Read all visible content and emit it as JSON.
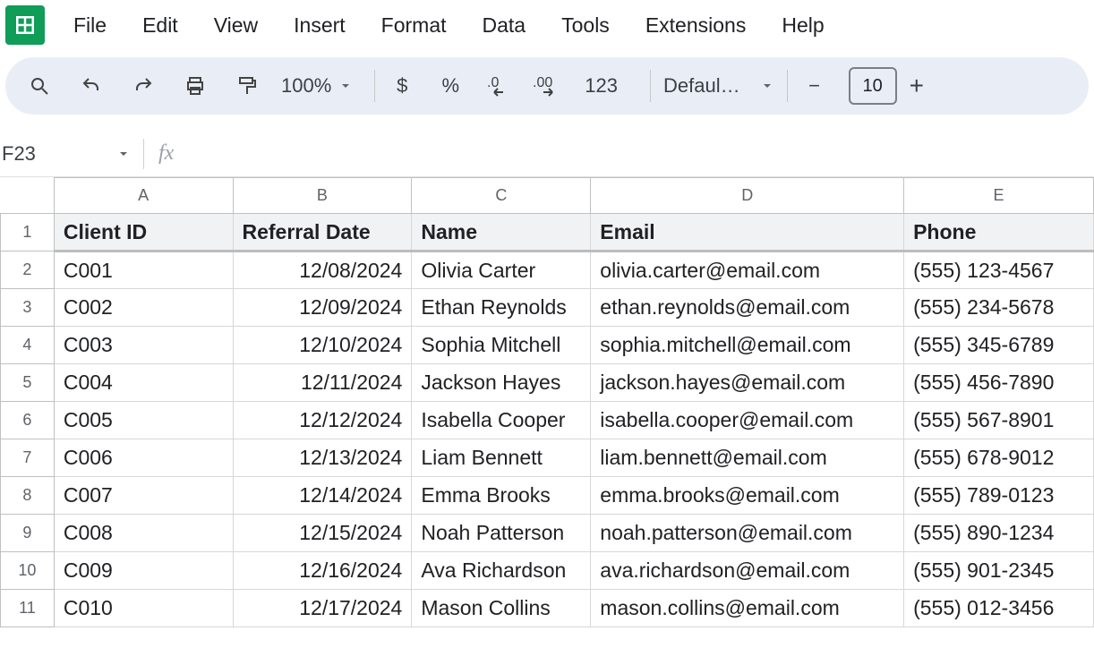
{
  "menu": {
    "file": "File",
    "edit": "Edit",
    "view": "View",
    "insert": "Insert",
    "format": "Format",
    "data": "Data",
    "tools": "Tools",
    "extensions": "Extensions",
    "help": "Help"
  },
  "toolbar": {
    "zoom": "100%",
    "currency": "$",
    "percent": "%",
    "decDecr": ".0",
    "decIncr": ".00",
    "numfmt": "123",
    "font": "Defaul…",
    "minus": "−",
    "fontsize": "10",
    "plus": "+"
  },
  "fx": {
    "namebox": "F23",
    "fx": "fx"
  },
  "columns": [
    "A",
    "B",
    "C",
    "D",
    "E"
  ],
  "rows": [
    "1",
    "2",
    "3",
    "4",
    "5",
    "6",
    "7",
    "8",
    "9",
    "10",
    "11"
  ],
  "header_row": {
    "A": "Client ID",
    "B": "Referral Date",
    "C": "Name",
    "D": "Email",
    "E": "Phone"
  },
  "data": [
    {
      "A": "C001",
      "B": "12/08/2024",
      "C": "Olivia Carter",
      "D": "olivia.carter@email.com",
      "E": "(555) 123-4567"
    },
    {
      "A": "C002",
      "B": "12/09/2024",
      "C": "Ethan Reynolds",
      "D": "ethan.reynolds@email.com",
      "E": "(555) 234-5678"
    },
    {
      "A": "C003",
      "B": "12/10/2024",
      "C": "Sophia Mitchell",
      "D": "sophia.mitchell@email.com",
      "E": "(555) 345-6789"
    },
    {
      "A": "C004",
      "B": "12/11/2024",
      "C": "Jackson Hayes",
      "D": "jackson.hayes@email.com",
      "E": "(555) 456-7890"
    },
    {
      "A": "C005",
      "B": "12/12/2024",
      "C": "Isabella Cooper",
      "D": "isabella.cooper@email.com",
      "E": "(555) 567-8901"
    },
    {
      "A": "C006",
      "B": "12/13/2024",
      "C": "Liam Bennett",
      "D": "liam.bennett@email.com",
      "E": "(555) 678-9012"
    },
    {
      "A": "C007",
      "B": "12/14/2024",
      "C": "Emma Brooks",
      "D": "emma.brooks@email.com",
      "E": "(555) 789-0123"
    },
    {
      "A": "C008",
      "B": "12/15/2024",
      "C": "Noah Patterson",
      "D": "noah.patterson@email.com",
      "E": "(555) 890-1234"
    },
    {
      "A": "C009",
      "B": "12/16/2024",
      "C": "Ava Richardson",
      "D": "ava.richardson@email.com",
      "E": "(555) 901-2345"
    },
    {
      "A": "C010",
      "B": "12/17/2024",
      "C": "Mason Collins",
      "D": "mason.collins@email.com",
      "E": "(555) 012-3456"
    }
  ]
}
